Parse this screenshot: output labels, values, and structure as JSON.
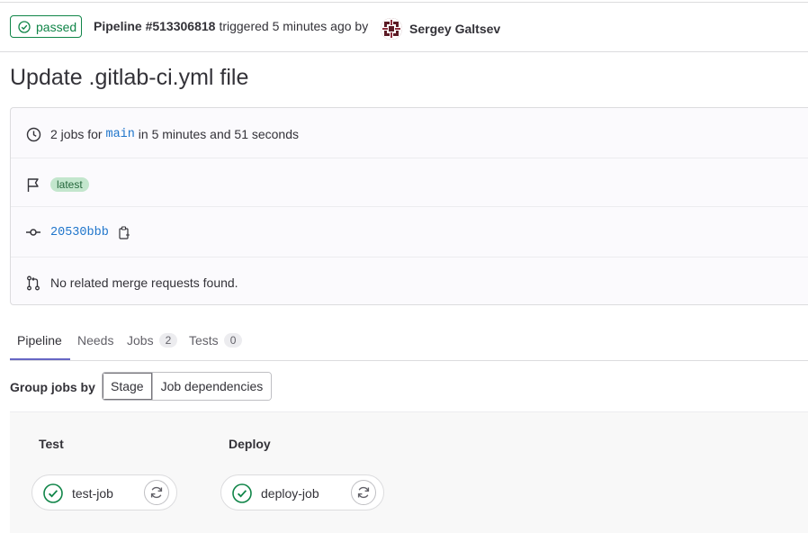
{
  "header": {
    "status_label": "passed",
    "pipeline_label": "Pipeline #513306818",
    "triggered_text": "triggered 5 minutes ago by",
    "author": "Sergey Galtsev"
  },
  "title": "Update .gitlab-ci.yml file",
  "info": {
    "jobs_prefix": "2 jobs for",
    "branch": "main",
    "duration_text": "in 5 minutes and 51 seconds",
    "tag": "latest",
    "commit_sha": "20530bbb",
    "merge_requests_text": "No related merge requests found."
  },
  "tabs": [
    {
      "label": "Pipeline"
    },
    {
      "label": "Needs"
    },
    {
      "label": "Jobs",
      "count": "2"
    },
    {
      "label": "Tests",
      "count": "0"
    }
  ],
  "group_by": {
    "label": "Group jobs by",
    "options": [
      "Stage",
      "Job dependencies"
    ],
    "selected": "Stage"
  },
  "stages": [
    {
      "title": "Test",
      "job": "test-job"
    },
    {
      "title": "Deploy",
      "job": "deploy-job"
    }
  ],
  "colors": {
    "success": "#108548",
    "link": "#1f75cb",
    "tab_active": "#6666c4"
  },
  "icons": [
    "status-success-icon",
    "clock-icon",
    "flag-icon",
    "commit-icon",
    "copy-icon",
    "merge-request-icon",
    "retry-icon"
  ]
}
